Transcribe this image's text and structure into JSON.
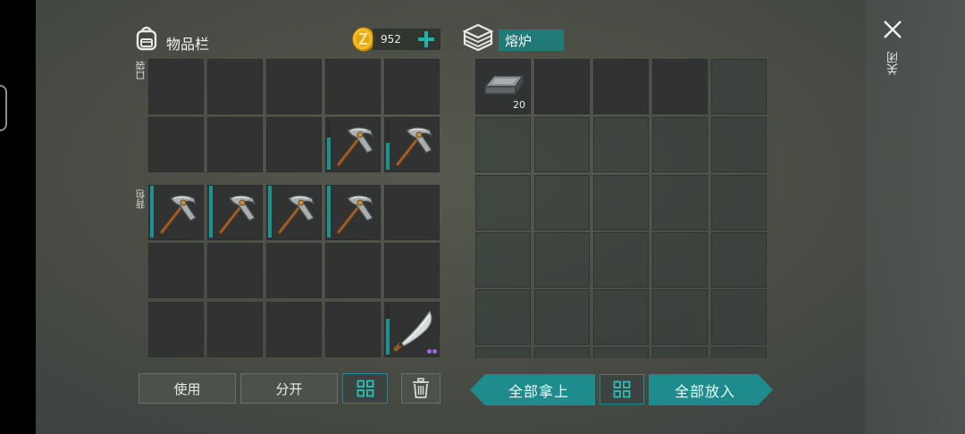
{
  "inventory": {
    "title": "物品栏",
    "coins": "952",
    "pocket_label": "口袋",
    "backpack_label": "背包"
  },
  "furnace": {
    "title": "熔炉",
    "iron_count": "20"
  },
  "buttons": {
    "use": "使用",
    "split": "分开",
    "take_all": "全部拿上",
    "put_all": "全部放入"
  },
  "close": {
    "label": "关闭"
  },
  "colors": {
    "accent": "#1e8c8c",
    "slot": "#363a37",
    "coin": "#e0a818"
  },
  "icons": {
    "backpack": "backpack-icon",
    "coin": "coin-icon",
    "plus": "plus-icon",
    "furnace": "furnace-icon",
    "close": "close-icon",
    "grid": "grid-icon",
    "trash": "trash-icon",
    "pickaxe": "pickaxe-icon",
    "machete": "machete-icon",
    "iron_ingot": "iron-ingot-icon"
  }
}
